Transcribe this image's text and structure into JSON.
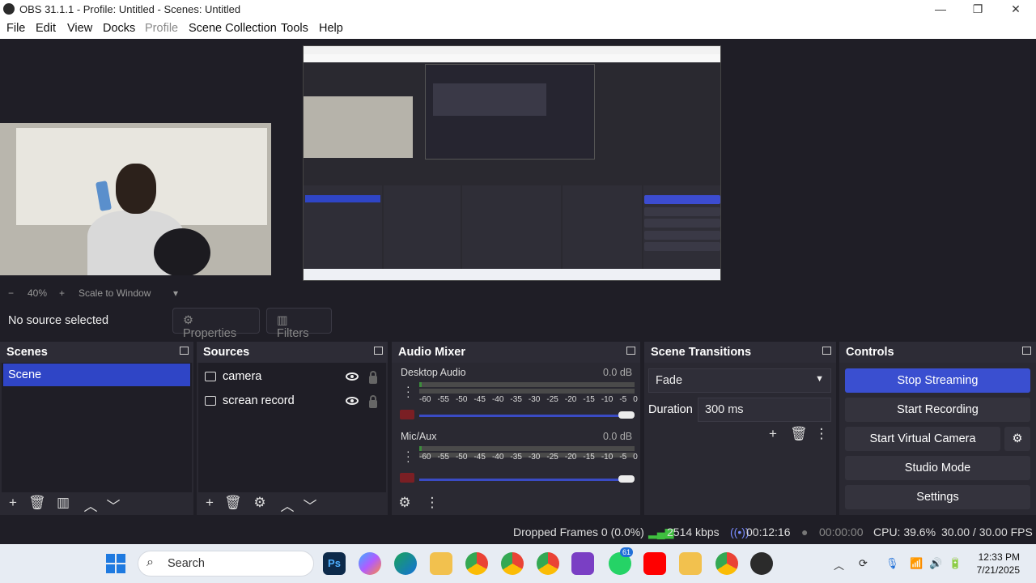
{
  "window": {
    "title": "OBS 31.1.1 - Profile: Untitled - Scenes: Untitled",
    "minimize": "—",
    "maximize": "❐",
    "close": "✕"
  },
  "menu": [
    "File",
    "Edit",
    "View",
    "Docks",
    "Profile",
    "Scene Collection",
    "Tools",
    "Help"
  ],
  "zoom": {
    "minus": "−",
    "value": "40%",
    "plus": "+",
    "mode": "Scale to Window",
    "caret": "▾"
  },
  "source_toolbar": {
    "no_source": "No source selected",
    "properties": "Properties",
    "filters": "Filters"
  },
  "scenes": {
    "title": "Scenes",
    "items": [
      "Scene"
    ]
  },
  "sources": {
    "title": "Sources",
    "items": [
      {
        "name": "camera",
        "icon": "camera-icon"
      },
      {
        "name": "screan record",
        "icon": "monitor-icon"
      }
    ]
  },
  "audio_mixer": {
    "title": "Audio Mixer",
    "scale": [
      "-60",
      "-55",
      "-50",
      "-45",
      "-40",
      "-35",
      "-30",
      "-25",
      "-20",
      "-15",
      "-10",
      "-5",
      "0"
    ],
    "channels": [
      {
        "name": "Desktop Audio",
        "db": "0.0 dB"
      },
      {
        "name": "Mic/Aux",
        "db": "0.0 dB"
      }
    ]
  },
  "transitions": {
    "title": "Scene Transitions",
    "selected": "Fade",
    "duration_label": "Duration",
    "duration_value": "300 ms"
  },
  "controls": {
    "title": "Controls",
    "buttons": [
      "Stop Streaming",
      "Start Recording",
      "Start Virtual Camera",
      "Studio Mode",
      "Settings"
    ]
  },
  "status": {
    "dropped": "Dropped Frames 0 (0.0%)",
    "bitrate": "2514 kbps",
    "stream_time": "00:12:16",
    "record_time": "00:00:00",
    "cpu": "CPU: 39.6%",
    "fps": "30.00 / 30.00 FPS"
  },
  "taskbar": {
    "search": "Search",
    "whatsapp_badge": "61",
    "time": "12:33 PM",
    "date": "7/21/2025",
    "ps_label": "Ps"
  },
  "colors": {
    "accent": "#3a4fd0",
    "bg": "#1f1e26",
    "dock": "#2a2932"
  }
}
